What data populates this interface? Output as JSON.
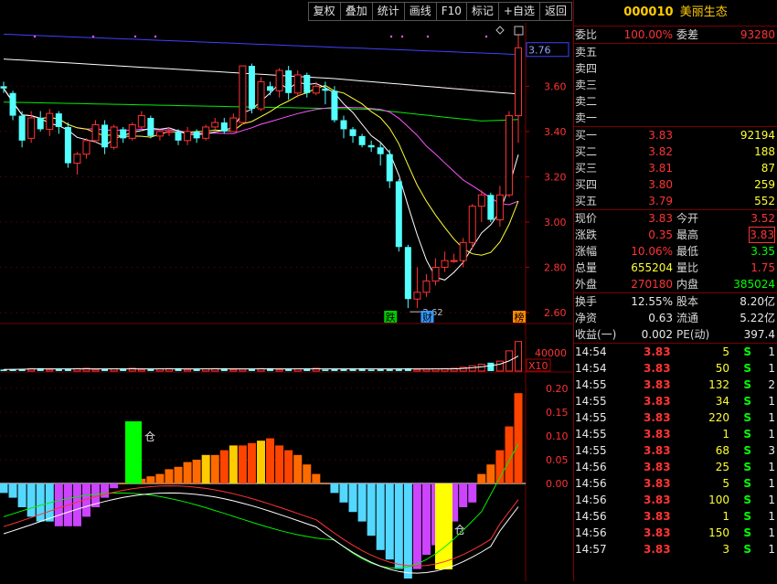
{
  "toolbar": {
    "buttons": [
      "复权",
      "叠加",
      "统计",
      "画线",
      "F10",
      "标记",
      "+自选",
      "返回"
    ]
  },
  "stock": {
    "code": "000010",
    "name": "美丽生态"
  },
  "quote": {
    "weibi_label": "委比",
    "weibi": "100.00%",
    "weicha_label": "委差",
    "weicha": "93280",
    "asks": [
      {
        "label": "卖五"
      },
      {
        "label": "卖四"
      },
      {
        "label": "卖三"
      },
      {
        "label": "卖二"
      },
      {
        "label": "卖一"
      }
    ],
    "bids": [
      {
        "label": "买一",
        "price": "3.83",
        "vol": "92194"
      },
      {
        "label": "买二",
        "price": "3.82",
        "vol": "188"
      },
      {
        "label": "买三",
        "price": "3.81",
        "vol": "87"
      },
      {
        "label": "买四",
        "price": "3.80",
        "vol": "259"
      },
      {
        "label": "买五",
        "price": "3.79",
        "vol": "552"
      }
    ],
    "stats": [
      {
        "l1": "现价",
        "v1": "3.83",
        "c1": "red",
        "l2": "今开",
        "v2": "3.52",
        "c2": "red"
      },
      {
        "l1": "涨跌",
        "v1": "0.35",
        "c1": "red",
        "l2": "最高",
        "v2": "3.83",
        "c2": "red",
        "boxed2": true
      },
      {
        "l1": "涨幅",
        "v1": "10.06%",
        "c1": "red",
        "l2": "最低",
        "v2": "3.35",
        "c2": "green"
      },
      {
        "l1": "总量",
        "v1": "655204",
        "c1": "yellow",
        "l2": "量比",
        "v2": "1.75",
        "c2": "red"
      },
      {
        "l1": "外盘",
        "v1": "270180",
        "c1": "red",
        "l2": "内盘",
        "v2": "385024",
        "c2": "green"
      }
    ],
    "fund": [
      {
        "l1": "换手",
        "v1": "12.55%",
        "l2": "股本",
        "v2": "8.20亿"
      },
      {
        "l1": "净资",
        "v1": "0.63",
        "l2": "流通",
        "v2": "5.22亿"
      },
      {
        "l1": "收益(一)",
        "v1": "0.002",
        "l2": "PE(动)",
        "v2": "397.4"
      }
    ]
  },
  "ticks": [
    {
      "time": "14:54",
      "price": "3.83",
      "vol": "5",
      "side": "S",
      "count": "1"
    },
    {
      "time": "14:54",
      "price": "3.83",
      "vol": "50",
      "side": "S",
      "count": "1"
    },
    {
      "time": "14:55",
      "price": "3.83",
      "vol": "132",
      "side": "S",
      "count": "2"
    },
    {
      "time": "14:55",
      "price": "3.83",
      "vol": "34",
      "side": "S",
      "count": "1"
    },
    {
      "time": "14:55",
      "price": "3.83",
      "vol": "220",
      "side": "S",
      "count": "1"
    },
    {
      "time": "14:55",
      "price": "3.83",
      "vol": "1",
      "side": "S",
      "count": "1"
    },
    {
      "time": "14:55",
      "price": "3.83",
      "vol": "68",
      "side": "S",
      "count": "3"
    },
    {
      "time": "14:56",
      "price": "3.83",
      "vol": "25",
      "side": "S",
      "count": "1"
    },
    {
      "time": "14:56",
      "price": "3.83",
      "vol": "5",
      "side": "S",
      "count": "1"
    },
    {
      "time": "14:56",
      "price": "3.83",
      "vol": "100",
      "side": "S",
      "count": "1"
    },
    {
      "time": "14:56",
      "price": "3.83",
      "vol": "1",
      "side": "S",
      "count": "1"
    },
    {
      "time": "14:56",
      "price": "3.83",
      "vol": "150",
      "side": "S",
      "count": "1"
    },
    {
      "time": "14:57",
      "price": "3.83",
      "vol": "3",
      "side": "S",
      "count": "1"
    }
  ],
  "chart_data": {
    "type": "candlestick",
    "price_axis": {
      "ticks": [
        "3.60",
        "3.40",
        "3.20",
        "3.00",
        "2.80",
        "2.60"
      ],
      "range": [
        2.56,
        3.88
      ],
      "current": "3.76"
    },
    "low_annotation": "2.62",
    "markers": [
      "跌",
      "财",
      "榜"
    ],
    "volume_axis": {
      "tick": "40000",
      "unit": "X10"
    },
    "indicator_axis": {
      "ticks": [
        "0.20",
        "0.15",
        "0.10",
        "0.05",
        "0.00"
      ],
      "range": [
        -0.21,
        0.21
      ]
    },
    "indicator_tags": [
      "仓",
      "仓"
    ],
    "colors": {
      "up": "#ff3333",
      "down": "#54ffff",
      "ma5": "#ffffff",
      "ma10": "#ffff33",
      "ma20": "#ff55ff",
      "ma60": "#00ee00",
      "ma120": "#ffffff",
      "ma250": "#4040ff"
    },
    "candles": [
      [
        3.6,
        3.59,
        3.62,
        3.57
      ],
      [
        3.57,
        3.47,
        3.58,
        3.45
      ],
      [
        3.47,
        3.36,
        3.49,
        3.33
      ],
      [
        3.37,
        3.46,
        3.49,
        3.35
      ],
      [
        3.46,
        3.41,
        3.49,
        3.4
      ],
      [
        3.41,
        3.48,
        3.5,
        3.38
      ],
      [
        3.48,
        3.42,
        3.49,
        3.39
      ],
      [
        3.42,
        3.26,
        3.44,
        3.24
      ],
      [
        3.26,
        3.3,
        3.31,
        3.21
      ],
      [
        3.3,
        3.36,
        3.37,
        3.28
      ],
      [
        3.36,
        3.43,
        3.45,
        3.35
      ],
      [
        3.43,
        3.33,
        3.45,
        3.3
      ],
      [
        3.33,
        3.42,
        3.43,
        3.32
      ],
      [
        3.41,
        3.37,
        3.42,
        3.35
      ],
      [
        3.37,
        3.43,
        3.44,
        3.36
      ],
      [
        3.42,
        3.47,
        3.49,
        3.41
      ],
      [
        3.46,
        3.38,
        3.47,
        3.37
      ],
      [
        3.38,
        3.4,
        3.41,
        3.36
      ],
      [
        3.4,
        3.4,
        3.42,
        3.38
      ],
      [
        3.4,
        3.36,
        3.41,
        3.34
      ],
      [
        3.36,
        3.4,
        3.42,
        3.34
      ],
      [
        3.4,
        3.37,
        3.41,
        3.35
      ],
      [
        3.37,
        3.42,
        3.43,
        3.36
      ],
      [
        3.42,
        3.44,
        3.46,
        3.41
      ],
      [
        3.44,
        3.4,
        3.46,
        3.39
      ],
      [
        3.4,
        3.46,
        3.48,
        3.4
      ],
      [
        3.44,
        3.69,
        3.69,
        3.43
      ],
      [
        3.69,
        3.5,
        3.7,
        3.48
      ],
      [
        3.5,
        3.62,
        3.64,
        3.49
      ],
      [
        3.6,
        3.58,
        3.62,
        3.56
      ],
      [
        3.58,
        3.67,
        3.68,
        3.55
      ],
      [
        3.67,
        3.57,
        3.69,
        3.54
      ],
      [
        3.57,
        3.65,
        3.67,
        3.55
      ],
      [
        3.65,
        3.57,
        3.66,
        3.55
      ],
      [
        3.57,
        3.6,
        3.62,
        3.56
      ],
      [
        3.59,
        3.58,
        3.62,
        3.52
      ],
      [
        3.58,
        3.45,
        3.6,
        3.44
      ],
      [
        3.45,
        3.41,
        3.47,
        3.37
      ],
      [
        3.41,
        3.38,
        3.42,
        3.35
      ],
      [
        3.38,
        3.34,
        3.39,
        3.33
      ],
      [
        3.34,
        3.33,
        3.36,
        3.31
      ],
      [
        3.33,
        3.3,
        3.35,
        3.25
      ],
      [
        3.3,
        3.18,
        3.32,
        3.15
      ],
      [
        3.18,
        2.89,
        3.19,
        2.87
      ],
      [
        2.89,
        2.66,
        2.9,
        2.62
      ],
      [
        2.66,
        2.69,
        2.8,
        2.62
      ],
      [
        2.69,
        2.74,
        2.77,
        2.67
      ],
      [
        2.74,
        2.8,
        2.84,
        2.72
      ],
      [
        2.8,
        2.83,
        2.87,
        2.78
      ],
      [
        2.83,
        2.83,
        2.86,
        2.82
      ],
      [
        2.83,
        2.91,
        2.93,
        2.8
      ],
      [
        2.91,
        3.07,
        3.08,
        2.88
      ],
      [
        3.07,
        3.12,
        3.14,
        3.0
      ],
      [
        3.12,
        3.01,
        3.13,
        3.0
      ],
      [
        3.01,
        3.12,
        3.16,
        2.98
      ],
      [
        3.12,
        3.47,
        3.49,
        3.11
      ],
      [
        3.47,
        3.77,
        3.83,
        3.35
      ]
    ]
  }
}
